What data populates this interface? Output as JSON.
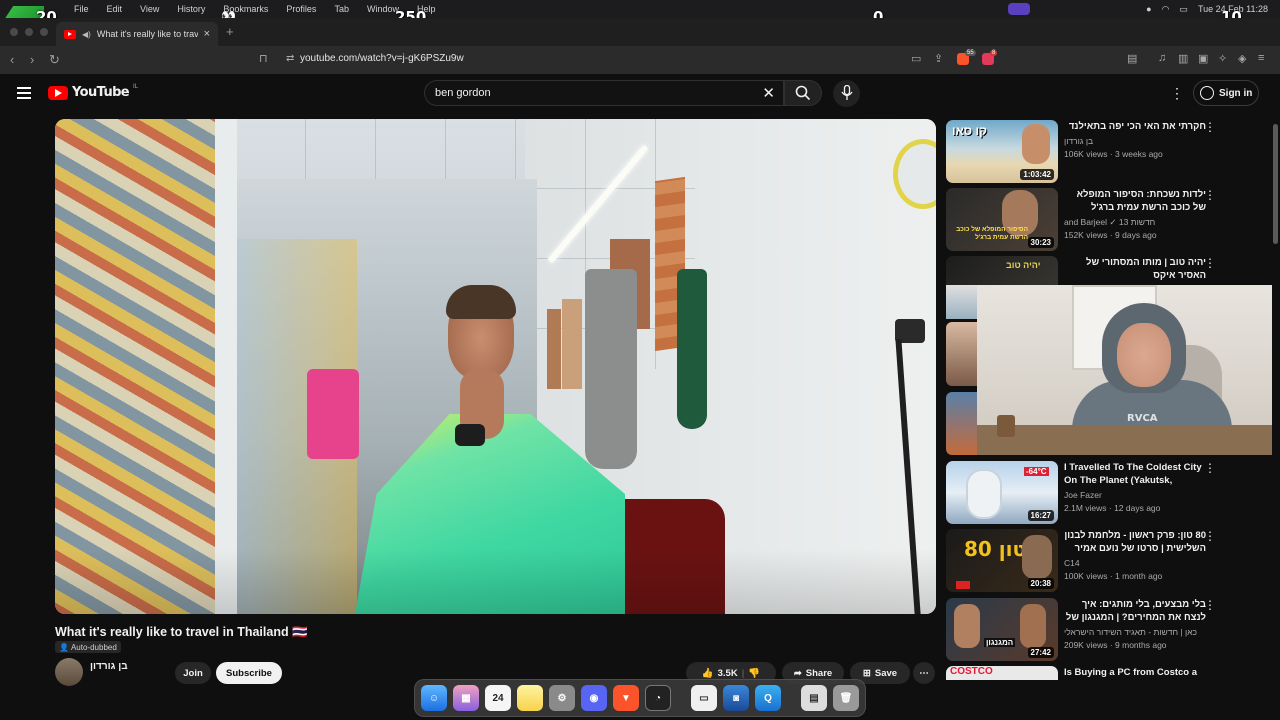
{
  "menubar": {
    "items": [
      "File",
      "Edit",
      "View",
      "History",
      "Bookmarks",
      "Profiles",
      "Tab",
      "Window",
      "Help"
    ],
    "clock": "Tue 24 Feb  11:28"
  },
  "overlay": {
    "score_left": "20",
    "score_mid": "250",
    "score_center": "0",
    "score_right": "10"
  },
  "browser": {
    "tab_title": "What it's really like to travel",
    "url": "youtube.com/watch?v=j-gK6PSZu9w",
    "ext_badge_a": "55",
    "ext_badge_b": "8"
  },
  "youtube": {
    "logo_text": "YouTube",
    "country_code": "IL",
    "search_query": "ben gordon",
    "signin_label": "Sign in"
  },
  "video": {
    "title": "What it's really like to travel in Thailand 🇹🇭",
    "autodub": "Auto-dubbed",
    "channel": "בן גורדון",
    "join_label": "Join",
    "subscribe_label": "Subscribe",
    "likes": "3.5K",
    "share_label": "Share",
    "save_label": "Save"
  },
  "sidebar": {
    "items": [
      {
        "title": "חקרתי את האי הכי יפה בתאילנד 🇹🇭",
        "channel": "בן גורדון",
        "meta": "106K views · 3 weeks ago",
        "duration": "1:03:42",
        "thumb_text": "קו סאו",
        "rtl": true
      },
      {
        "title": "ילדות נשכחת: הסיפור המופלא של כוכב הרשת עמית ברג'ל",
        "channel": "and Barjeel ✓ חדשות 13",
        "meta": "152K views · 9 days ago",
        "duration": "30:23",
        "thumb_text": "הסיפור המופלא של כוכב הרשת עמית ברג'ל",
        "rtl": true
      },
      {
        "title": "יהיה טוב | מותו המסתורי של האסיר איקס",
        "channel": "",
        "meta": "",
        "duration": "",
        "thumb_text": "יהיה טוב",
        "rtl": true
      },
      {
        "title": "I Travelled To The Coldest City On The Planet (Yakutsk, Russia)",
        "channel": "Joe Fazer",
        "meta": "2.1M views · 12 days ago",
        "duration": "16:27",
        "thumb_text": "-64°C",
        "rtl": false
      },
      {
        "title": "80 טון: פרק ראשון - מלחמת לבנון השלישית | סרטו של נועם אמיר",
        "channel": "C14",
        "meta": "100K views · 1 month ago",
        "duration": "20:38",
        "thumb_text": "80 טון",
        "rtl": true
      },
      {
        "title": "בלי מבצעים, בלי מותגים: איך לנצח את המחירים? | המגנגון של קלות את יוקר המחיה",
        "channel": "כאן | חדשות - תאגיד השידור הישראלי",
        "meta": "209K views · 9 months ago",
        "duration": "27:42",
        "thumb_text": "המגנגון",
        "rtl": true
      },
      {
        "title": "Is Buying a PC from Costco a",
        "channel": "",
        "meta": "",
        "duration": "",
        "thumb_text": "COSTCO",
        "rtl": false
      }
    ]
  },
  "webcam": {
    "shirt_text": "RVCA"
  },
  "dock": {
    "calendar_day": "24"
  }
}
